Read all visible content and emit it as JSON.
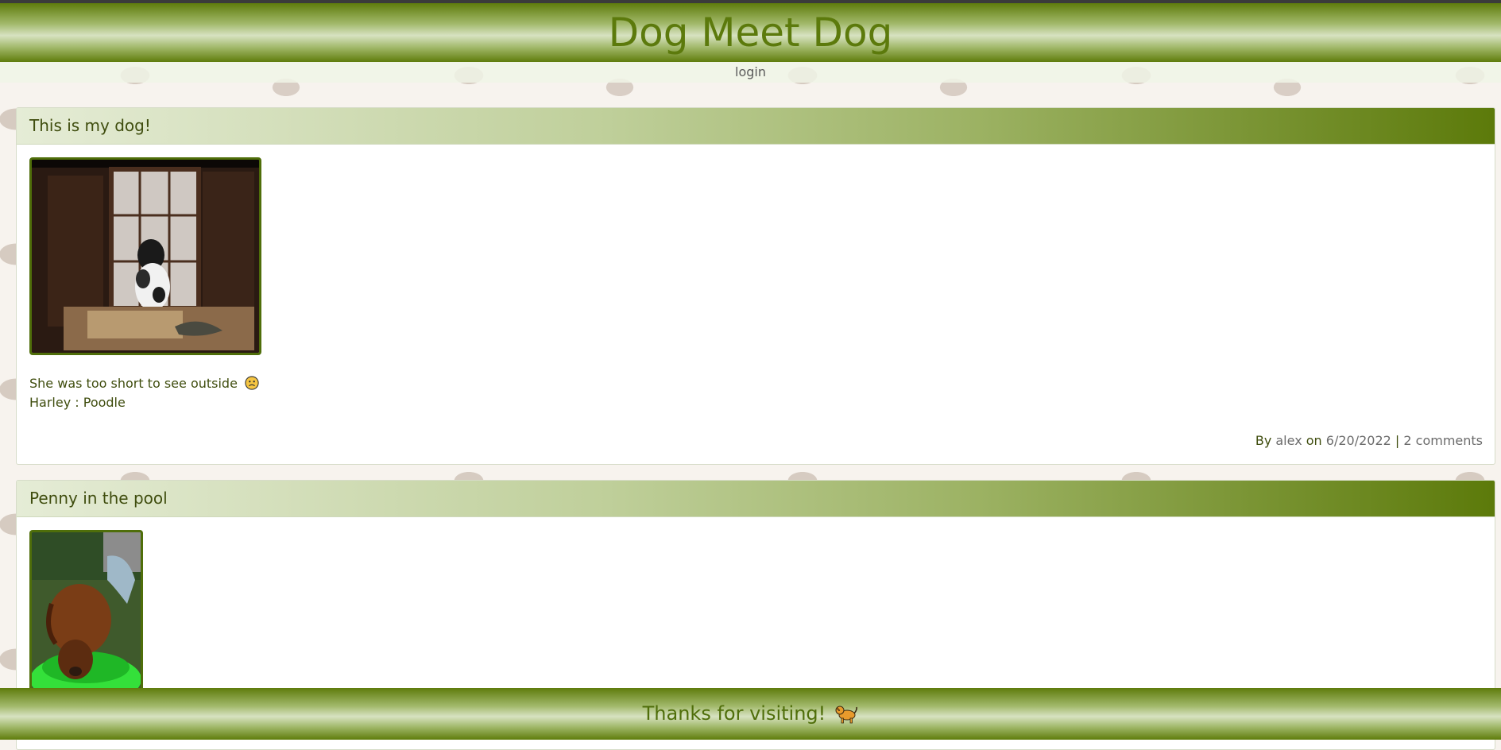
{
  "site": {
    "title": "Dog Meet Dog",
    "nav_login": "login"
  },
  "posts": [
    {
      "title": "This is my dog!",
      "image_icon": "dog-photo-window",
      "caption": "She was too short to see outside",
      "caption_emoji_icon": "sad-face-icon",
      "dog_name": "Harley",
      "dog_separator": " : ",
      "dog_breed": "Poodle",
      "meta": {
        "by_label": "By ",
        "author": "alex",
        "on_label": " on ",
        "date": "6/20/2022",
        "separator": " | ",
        "comments": "2 comments"
      }
    },
    {
      "title": "Penny in the pool",
      "image_icon": "dog-photo-pool"
    }
  ],
  "footer": {
    "text": "Thanks for visiting!",
    "emoji_icon": "dog-emoji-icon"
  },
  "colors": {
    "brand_green": "#5c7a0c",
    "text_dark_green": "#3f4d0e",
    "link_gray": "#6b6b6b"
  }
}
